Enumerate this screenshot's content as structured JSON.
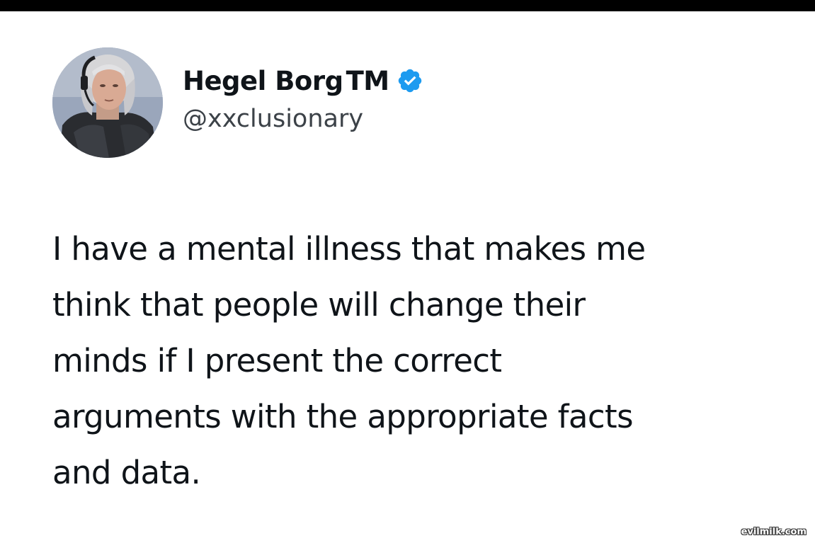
{
  "colors": {
    "text_primary": "#0f1419",
    "text_secondary": "#3c4248",
    "verified_badge": "#1d9bf0",
    "top_bar": "#000000",
    "background": "#ffffff"
  },
  "author": {
    "display_name": "Hegel Borg",
    "trademark": "TM",
    "handle": "@xxclusionary",
    "verified_icon": "verified-badge-icon",
    "avatar_icon": "profile-photo"
  },
  "tweet": {
    "lines": [
      "I have a mental illness that makes me",
      "think that people will change their",
      "minds if I present the correct",
      "arguments with the appropriate facts",
      "and data."
    ]
  },
  "watermark": {
    "text": "evilmilk.com"
  }
}
